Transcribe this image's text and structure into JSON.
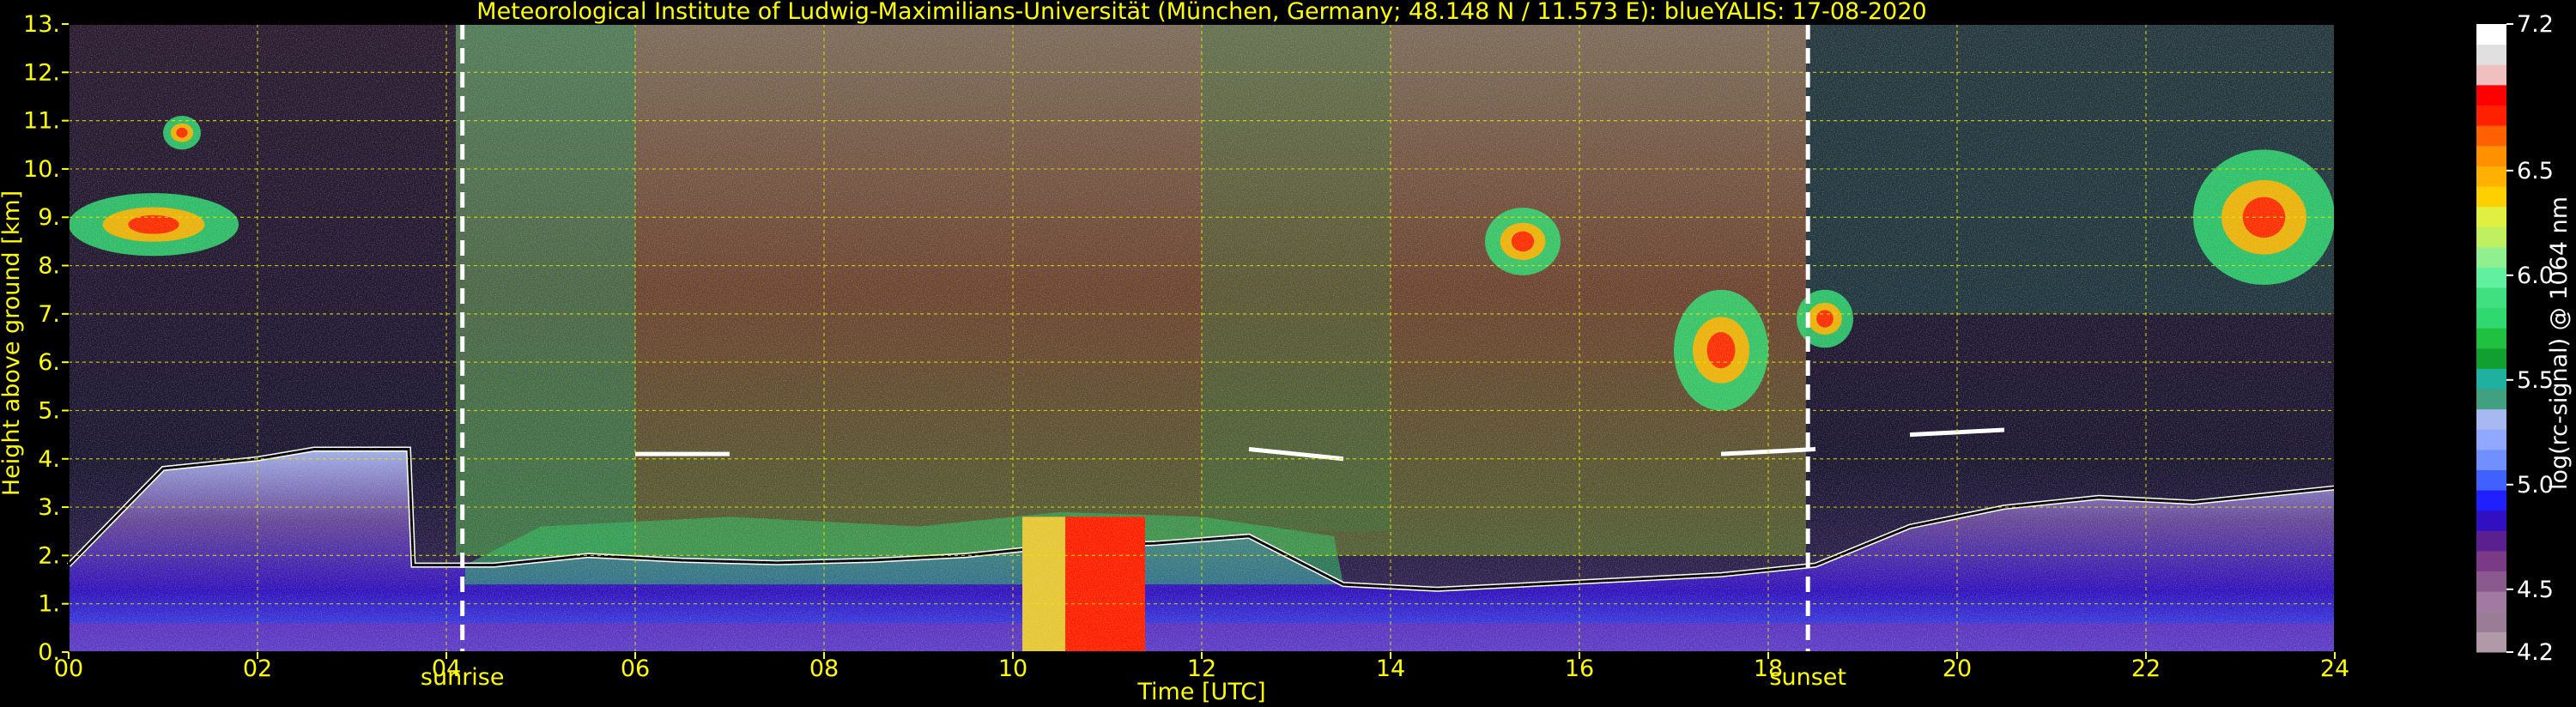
{
  "colors": {
    "background": "#000000",
    "text": "#ffff00",
    "grid": "#e6e600",
    "cbar_text": "#ffffff",
    "event_line": "#ffffff"
  },
  "chart_data": {
    "type": "heatmap",
    "title": "Meteorological Institute of Ludwig-Maximilians-Universität (München, Germany; 48.148 N / 11.573 E):     blueYALIS: 17-08-2020",
    "xlabel": "Time [UTC]",
    "ylabel": "Height above ground [km]",
    "xlim": [
      0,
      24
    ],
    "ylim": [
      0,
      13
    ],
    "x_ticks": [
      "00",
      "02",
      "04",
      "06",
      "08",
      "10",
      "12",
      "14",
      "16",
      "18",
      "20",
      "22",
      "24"
    ],
    "y_ticks": [
      "0.",
      "1.",
      "2.",
      "3.",
      "4.",
      "5.",
      "6.",
      "7.",
      "8.",
      "9.",
      "10.",
      "11.",
      "12.",
      "13."
    ],
    "grid": true,
    "events": [
      {
        "label": "sunrise",
        "time": 4.17
      },
      {
        "label": "sunset",
        "time": 18.42
      }
    ],
    "colorbar": {
      "label": "log(rc-signal) @ 1064 nm",
      "range": [
        4.2,
        7.2
      ],
      "ticks": [
        "4.2",
        "4.5",
        "5.0",
        "5.5",
        "6.0",
        "6.5",
        "7.2"
      ],
      "colors": [
        "#b09aa8",
        "#9a7c96",
        "#a07aa0",
        "#8a5a8e",
        "#7a3a86",
        "#5a2090",
        "#3010c0",
        "#2020ff",
        "#4060ff",
        "#7090ff",
        "#90a8ff",
        "#a8b8f0",
        "#40a080",
        "#20b0a0",
        "#10a030",
        "#20c040",
        "#30d870",
        "#40e080",
        "#60f0a0",
        "#90f090",
        "#c0f060",
        "#e0f040",
        "#ffd000",
        "#ffb000",
        "#ff9000",
        "#ff6000",
        "#ff2000",
        "#ff0000",
        "#f0c0c0",
        "#e0e0e0",
        "#ffffff"
      ]
    },
    "features": {
      "boundary_layer_top_km": [
        [
          0.0,
          1.8
        ],
        [
          1.0,
          3.8
        ],
        [
          2.0,
          4.0
        ],
        [
          2.6,
          4.2
        ],
        [
          3.6,
          4.2
        ],
        [
          3.65,
          1.8
        ],
        [
          4.5,
          1.8
        ],
        [
          5.5,
          2.0
        ],
        [
          6.5,
          1.9
        ],
        [
          7.5,
          1.85
        ],
        [
          8.5,
          1.9
        ],
        [
          9.5,
          2.0
        ],
        [
          10.5,
          2.2
        ],
        [
          11.5,
          2.25
        ],
        [
          12.5,
          2.4
        ],
        [
          13.5,
          1.4
        ],
        [
          14.5,
          1.3
        ],
        [
          15.5,
          1.4
        ],
        [
          16.5,
          1.5
        ],
        [
          17.5,
          1.6
        ],
        [
          18.5,
          1.8
        ],
        [
          19.5,
          2.6
        ],
        [
          20.5,
          3.0
        ],
        [
          21.5,
          3.2
        ],
        [
          22.5,
          3.1
        ],
        [
          24.0,
          3.4
        ]
      ],
      "aerosol_layer_4km": [
        [
          6.0,
          4.1
        ],
        [
          7.0,
          4.1
        ],
        [
          12.5,
          4.2
        ],
        [
          13.5,
          4.0
        ],
        [
          17.5,
          4.1
        ],
        [
          18.5,
          4.2
        ],
        [
          19.5,
          4.5
        ],
        [
          20.5,
          4.6
        ]
      ],
      "cirrus_patches": [
        {
          "t0": 0.0,
          "t1": 1.8,
          "h0": 8.2,
          "h1": 9.5
        },
        {
          "t0": 1.0,
          "t1": 1.4,
          "h0": 10.4,
          "h1": 11.1
        },
        {
          "t0": 15.0,
          "t1": 15.8,
          "h0": 7.8,
          "h1": 9.2
        },
        {
          "t0": 17.0,
          "t1": 18.0,
          "h0": 5.0,
          "h1": 7.5
        },
        {
          "t0": 18.3,
          "t1": 18.9,
          "h0": 6.3,
          "h1": 7.5
        },
        {
          "t0": 22.5,
          "t1": 24.0,
          "h0": 7.6,
          "h1": 10.4
        }
      ],
      "low_cloud_strong": {
        "t0": 10.1,
        "t1": 11.4,
        "h0": 0.0,
        "h1": 2.8
      }
    }
  }
}
